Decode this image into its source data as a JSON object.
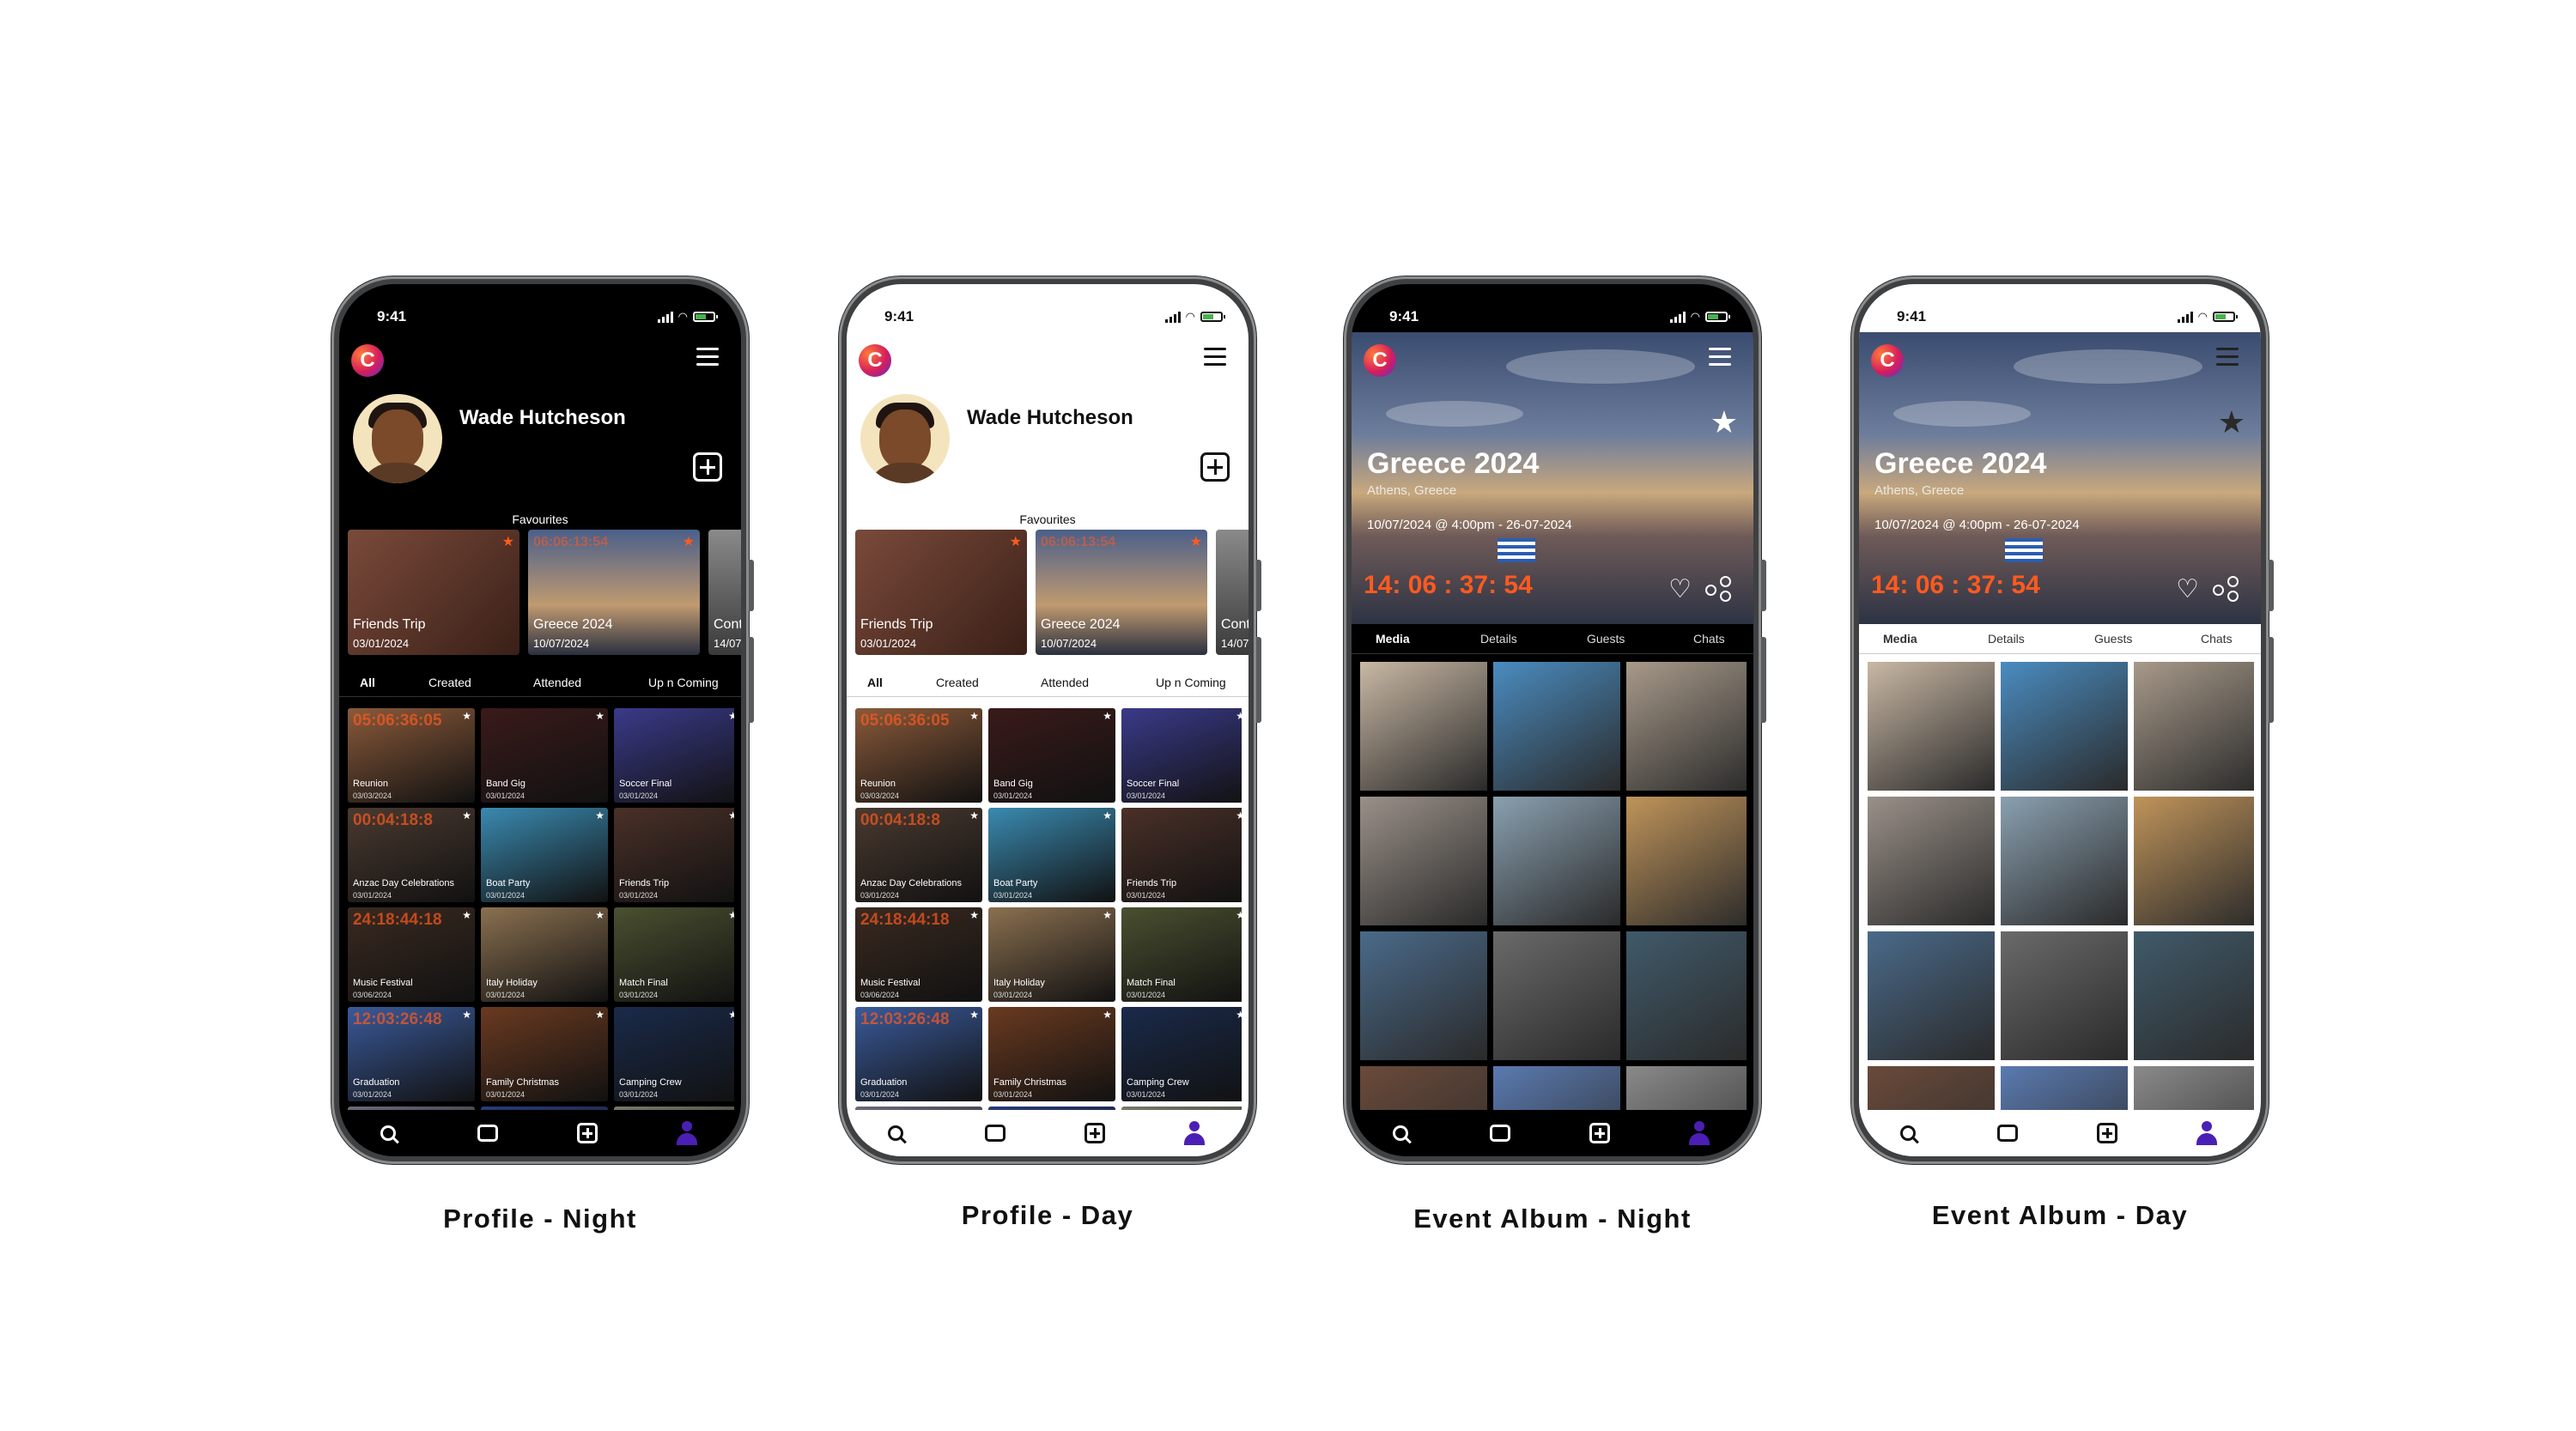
{
  "status_time": "9:41",
  "profile": {
    "user_name": "Wade Hutcheson",
    "favourites_label": "Favourites",
    "favourites": [
      {
        "title": "Friends Trip",
        "date": "03/01/2024",
        "countdown": "",
        "color": "#5a3a30"
      },
      {
        "title": "Greece 2024",
        "date": "10/07/2024",
        "countdown": "06:06:13:54",
        "color": "#4a5b78"
      },
      {
        "title": "Conti",
        "date": "14/07",
        "countdown": "",
        "color": "#6a6a6a"
      }
    ],
    "tabs": [
      "All",
      "Created",
      "Attended",
      "Up n Coming"
    ],
    "events": [
      {
        "title": "Reunion",
        "date": "03/03/2024",
        "countdown": "05:06:36:05",
        "color": "#8a5a3a"
      },
      {
        "title": "Band Gig",
        "date": "03/01/2024",
        "countdown": "",
        "color": "#3a1a1a"
      },
      {
        "title": "Soccer Final",
        "date": "03/01/2024",
        "countdown": "",
        "color": "#3a3a8a"
      },
      {
        "title": "Anzac Day Celebrations",
        "date": "03/01/2024",
        "countdown": "00:04:18:8",
        "color": "#4a3a30"
      },
      {
        "title": "Boat Party",
        "date": "03/01/2024",
        "countdown": "",
        "color": "#3a8ab0"
      },
      {
        "title": "Friends Trip",
        "date": "03/01/2024",
        "countdown": "",
        "color": "#4a3028"
      },
      {
        "title": "Music Festival",
        "date": "03/06/2024",
        "countdown": "24:18:44:18",
        "color": "#3a2a20"
      },
      {
        "title": "Italy Holiday",
        "date": "03/01/2024",
        "countdown": "",
        "color": "#8a7050"
      },
      {
        "title": "Match Final",
        "date": "03/01/2024",
        "countdown": "",
        "color": "#4a5030"
      },
      {
        "title": "Graduation",
        "date": "03/01/2024",
        "countdown": "12:03:26:48",
        "color": "#3a5a9a"
      },
      {
        "title": "Family Christmas",
        "date": "03/01/2024",
        "countdown": "",
        "color": "#6a3a20"
      },
      {
        "title": "Camping Crew",
        "date": "03/01/2024",
        "countdown": "",
        "color": "#1a2a4a"
      },
      {
        "title": "",
        "date": "",
        "countdown": "",
        "color": "#6a6a7a"
      },
      {
        "title": "",
        "date": "",
        "countdown": "",
        "color": "#2a3a7a"
      },
      {
        "title": "",
        "date": "",
        "countdown": "",
        "color": "#7a7a6a"
      }
    ]
  },
  "album": {
    "title": "Greece 2024",
    "location": "Athens, Greece",
    "dates": "10/07/2024 @ 4:00pm - 26-07-2024",
    "countdown": "14: 06 : 37: 54",
    "tabs": [
      "Media",
      "Details",
      "Guests",
      "Chats"
    ],
    "photos": [
      "#c9b8a4",
      "#4a8cc0",
      "#a89a8a",
      "#9a9088",
      "#8aa0b0",
      "#c0945a",
      "#4a6a8a",
      "#6a6a6a",
      "#405a6a",
      "#6a4a3a",
      "#5a7ab0",
      "#8a8a8a"
    ]
  },
  "captions": [
    "Profile - Night",
    "Profile - Day",
    "Event Album - Night",
    "Event Album - Day"
  ],
  "colors": {
    "accent": "#ff5a1f",
    "brand": "#4b1fb5"
  }
}
